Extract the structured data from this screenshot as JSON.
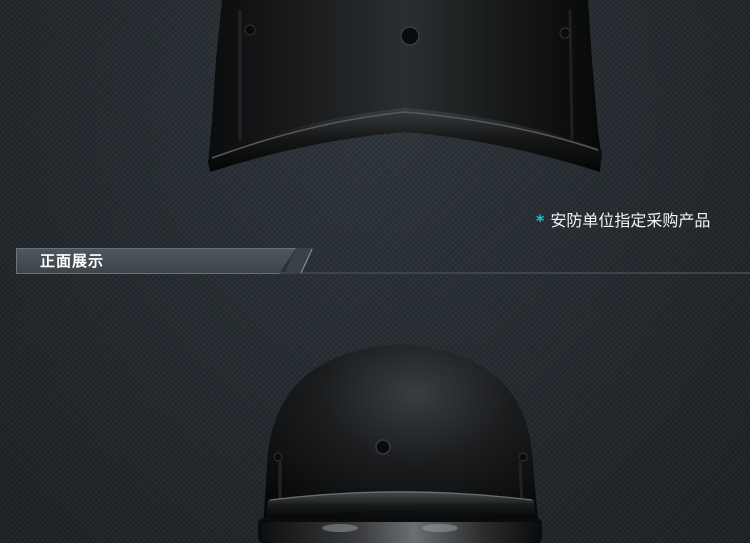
{
  "tagline": {
    "star": "*",
    "text": "安防单位指定采购产品"
  },
  "section": {
    "title": "正面展示"
  },
  "colors": {
    "background": "#262c31",
    "accent": "#1ec3d8",
    "tab": "#4a5258"
  }
}
